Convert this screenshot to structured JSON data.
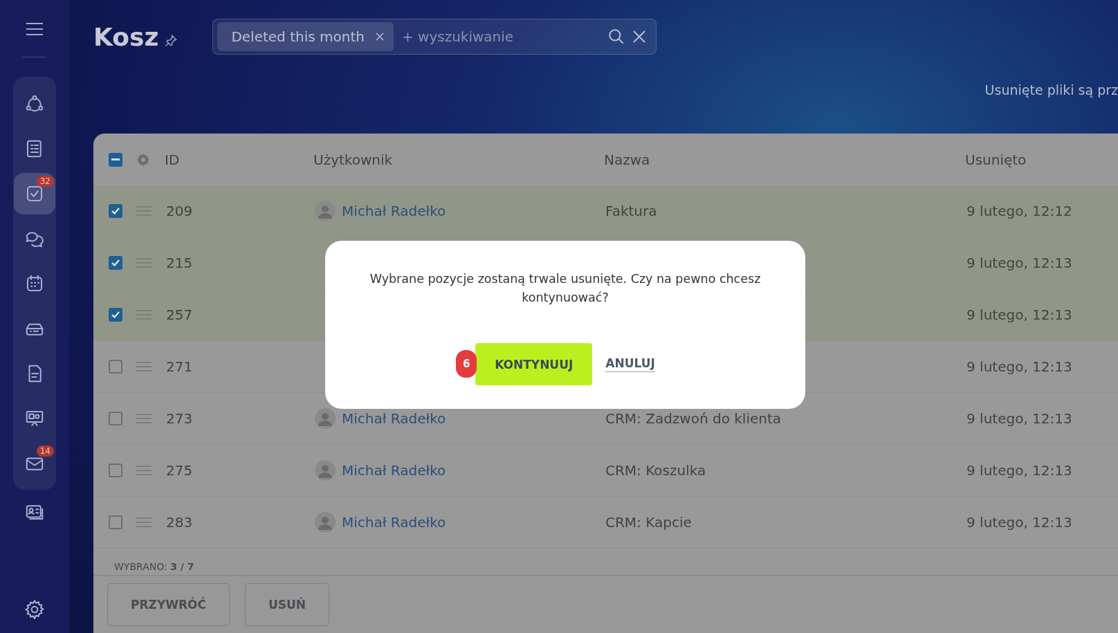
{
  "sidebar": {
    "items": [
      {
        "selected": false
      },
      {
        "selected": false
      },
      {
        "selected": true,
        "badge": "32"
      },
      {
        "selected": false
      },
      {
        "selected": false
      },
      {
        "selected": false
      },
      {
        "selected": false
      },
      {
        "selected": false
      },
      {
        "selected": false,
        "badge": "14"
      },
      {
        "selected": false
      }
    ]
  },
  "header": {
    "title": "Kosz",
    "filter_chip": "Deleted this month",
    "search": {
      "placeholder": "+ wyszukiwanie"
    },
    "info": "Usunięte pliki są prz"
  },
  "table": {
    "select_all": {
      "indeterminate": true
    },
    "columns": [
      "ID",
      "Użytkownik",
      "Nazwa",
      "Usunięto"
    ],
    "rows": [
      {
        "checked": true,
        "id": "209",
        "user": "Michał Radełko",
        "name": "Faktura",
        "deleted": "9 lutego, 12:12"
      },
      {
        "checked": true,
        "id": "215",
        "deleted": "9 lutego, 12:13"
      },
      {
        "checked": true,
        "id": "257",
        "deleted": "9 lutego, 12:13"
      },
      {
        "checked": false,
        "id": "271",
        "deleted": "9 lutego, 12:13"
      },
      {
        "checked": false,
        "id": "273",
        "user": "Michał Radełko",
        "name": "CRM: Zadzwoń do klienta",
        "deleted": "9 lutego, 12:13"
      },
      {
        "checked": false,
        "id": "275",
        "user": "Michał Radełko",
        "name": "CRM: Koszulka",
        "deleted": "9 lutego, 12:13"
      },
      {
        "checked": false,
        "id": "283",
        "user": "Michał Radełko",
        "name": "CRM: Kapcie",
        "deleted": "9 lutego, 12:13"
      }
    ],
    "selection_count": "WYBRANO: **3 / 7**"
  },
  "footer": {
    "buttons": [
      "PRZYWRÓĆ",
      "USUŃ"
    ]
  },
  "dialog": {
    "message": "Wybrane pozycje zostaną trwale usunięte. Czy na pewno chcesz kontynuować?",
    "step_badge": "6",
    "confirm": "KONTYNUUJ",
    "cancel": "ANULUJ"
  }
}
